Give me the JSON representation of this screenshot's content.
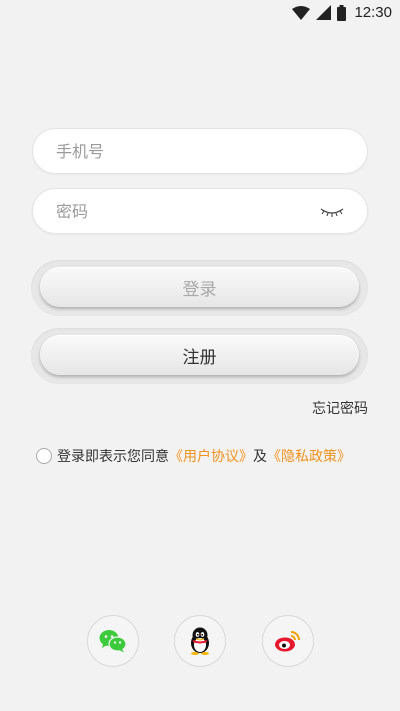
{
  "status_bar": {
    "time": "12:30",
    "icons": [
      "wifi-icon",
      "signal-icon",
      "battery-icon"
    ]
  },
  "form": {
    "phone_placeholder": "手机号",
    "phone_value": "",
    "password_placeholder": "密码",
    "password_value": "",
    "password_toggle_icon": "eye-closed-icon"
  },
  "buttons": {
    "login_label": "登录",
    "register_label": "注册",
    "forgot_password": "忘记密码"
  },
  "agreement": {
    "prefix": "登录即表示您同意",
    "user_agreement": "《用户协议》",
    "conjunction": "及",
    "privacy_policy": "《隐私政策》",
    "checked": false
  },
  "social_login": [
    {
      "name": "wechat",
      "icon": "wechat-icon",
      "color": "#3dcb3d"
    },
    {
      "name": "qq",
      "icon": "qq-penguin-icon",
      "color": "#111111"
    },
    {
      "name": "weibo",
      "icon": "weibo-icon",
      "color": "#e6162d"
    }
  ],
  "colors": {
    "background": "#f2f2f2",
    "link": "#f0921e",
    "login_disabled_text": "#a9a9a9"
  }
}
